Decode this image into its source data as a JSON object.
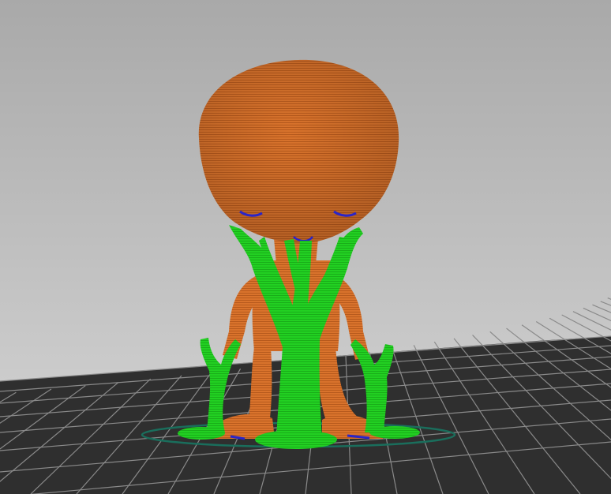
{
  "viewport": {
    "description_free": true,
    "background": {
      "top_color": "#a9a9a9",
      "bottom_color": "#d6d6d6"
    },
    "bed": {
      "color": "#2f2f2f",
      "grid_color": "#8a8a8a"
    },
    "model": {
      "body_color": "#d9732c",
      "body_line_color": "#a84f16",
      "support_color": "#22d022",
      "support_line_color": "#14a014",
      "overhang_color": "#2a25c8",
      "skirt_color": "#1a6e5c"
    }
  }
}
